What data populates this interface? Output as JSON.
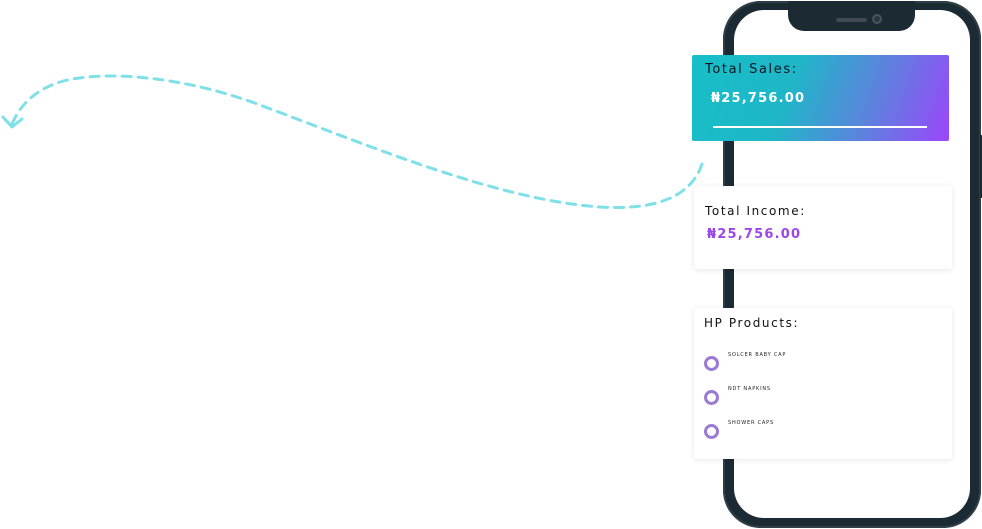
{
  "total_sales": {
    "title": "Total Sales:",
    "value": "₦25,756.00"
  },
  "total_income": {
    "title": "Total Income:",
    "value": "₦25,756.00"
  },
  "products": {
    "title": "HP Products:",
    "items": [
      {
        "label": "SOLCER  BABY CAP"
      },
      {
        "label": "NDT NAPKINS"
      },
      {
        "label": "SHOWER CAPS"
      }
    ]
  },
  "colors": {
    "accent_purple": "#9b46e8",
    "gradient_start": "#17bfc7",
    "gradient_end": "#9b46fb",
    "dashed_line": "#7fe0e8",
    "phone_frame": "#1c2a33"
  }
}
